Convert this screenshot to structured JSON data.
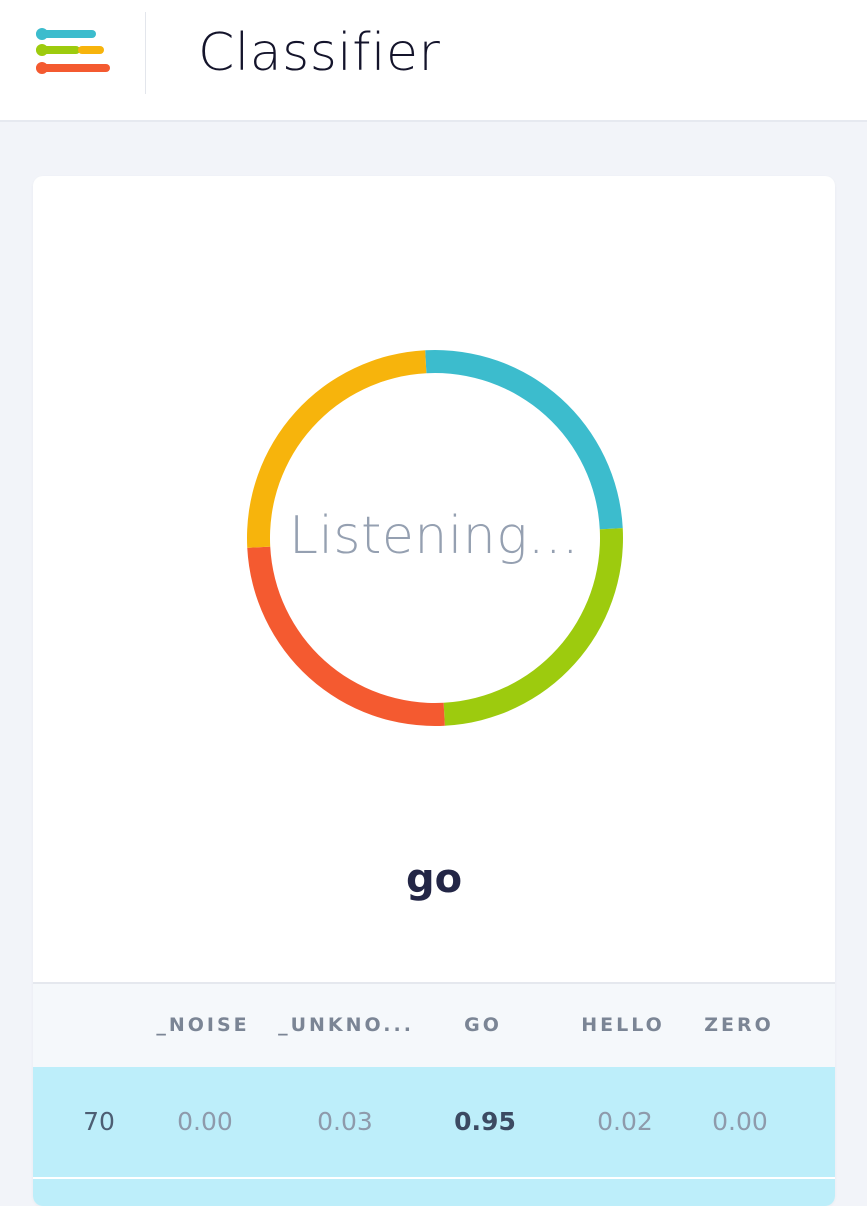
{
  "header": {
    "title": "Classifier",
    "logo_icon": "menu-logo-icon",
    "logo_colors": [
      "#3cbccd",
      "#9dcb0e",
      "#f7b40c",
      "#f45a30"
    ]
  },
  "classifier": {
    "status": "Listening...",
    "prediction": "go",
    "ring_colors": [
      "#3cbccd",
      "#9dcb0e",
      "#f45a30",
      "#f7b40c"
    ]
  },
  "table": {
    "columns": [
      "",
      "_NOISE",
      "_UNKNO...",
      "GO",
      "HELLO",
      "ZERO"
    ],
    "rows": [
      {
        "index": "70",
        "values": [
          "0.00",
          "0.03",
          "0.95",
          "0.02",
          "0.00"
        ],
        "highlight_color": "#bdeefa"
      }
    ]
  }
}
